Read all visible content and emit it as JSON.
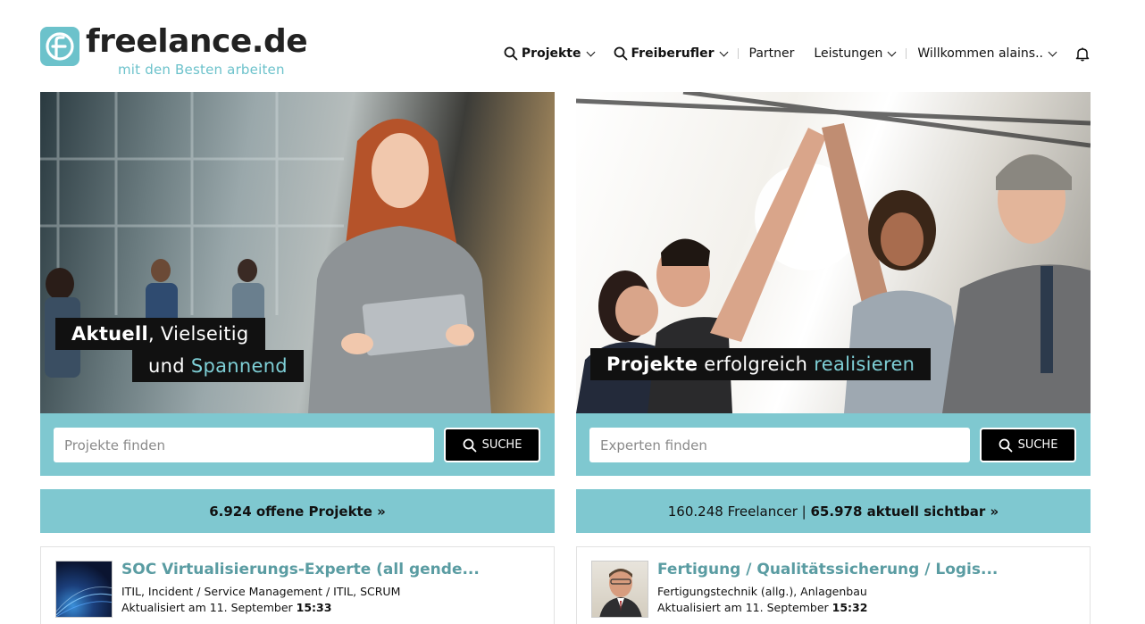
{
  "brand": {
    "name": "freelance.de",
    "tagline": "mit den Besten arbeiten",
    "accent": "#7fc8d0",
    "title_color": "#5a9ca2"
  },
  "nav": {
    "projects": "Projekte",
    "freelancers": "Freiberufler",
    "partner": "Partner",
    "services": "Leistungen",
    "user": "Willkommen alains..",
    "bell_icon": "bell-icon"
  },
  "left": {
    "hero_line1_bold": "Aktuell",
    "hero_line1_rest": ", Vielseitig",
    "hero_line2_pre": "und ",
    "hero_line2_accent": "Spannend",
    "search_placeholder": "Projekte finden",
    "search_button": "SUCHE",
    "count": "6.924 offene Projekte »",
    "card": {
      "title": "SOC Virtualisierungs-Experte (all gende...",
      "subtitle": "ITIL, Incident / Service Management / ITIL, SCRUM",
      "date_prefix": "Aktualisiert am 11. September ",
      "time": "15:33"
    }
  },
  "right": {
    "hero_bold": "Projekte",
    "hero_mid": " erfolgreich ",
    "hero_accent": "realisieren",
    "search_placeholder": "Experten finden",
    "search_button": "SUCHE",
    "count_prefix": "160.248 Freelancer | ",
    "count_bold": "65.978 aktuell sichtbar »",
    "card": {
      "title": "Fertigung / Qualitätssicherung / Logis...",
      "subtitle": "Fertigungstechnik (allg.), Anlagenbau",
      "date_prefix": "Aktualisiert am 11. September ",
      "time": "15:32"
    }
  }
}
